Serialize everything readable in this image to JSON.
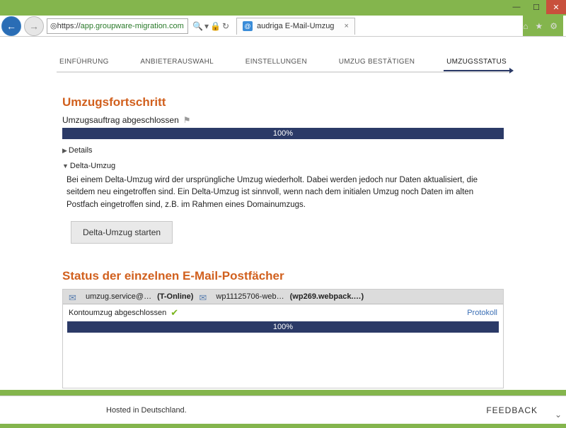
{
  "window": {
    "url_prefix": "https://",
    "url_host": "app.groupware-migration.com",
    "tab_title": "audriga E-Mail-Umzug"
  },
  "steps": {
    "s1": "EINFÜHRUNG",
    "s2": "ANBIETERAUSWAHL",
    "s3": "EINSTELLUNGEN",
    "s4": "UMZUG BESTÄTIGEN",
    "s5": "UMZUGSSTATUS"
  },
  "progress": {
    "heading": "Umzugsfortschritt",
    "status": "Umzugsauftrag abgeschlossen",
    "percent": "100%",
    "details_label": "Details",
    "delta_label": "Delta-Umzug",
    "delta_text": "Bei einem Delta-Umzug wird der ursprüngliche Umzug wiederholt. Dabei werden jedoch nur Daten aktualisiert, die seitdem neu eingetroffen sind. Ein Delta-Umzug ist sinnvoll, wenn nach dem initialen Umzug noch Daten im alten Postfach eingetroffen sind, z.B. im Rahmen eines Domainumzugs.",
    "delta_button": "Delta-Umzug starten"
  },
  "mailboxes": {
    "heading": "Status der einzelnen E-Mail-Postfächer",
    "from_addr": "umzug.service@…",
    "from_provider": "(T-Online)",
    "to_addr": "wp11125706-web…",
    "to_provider": "(wp269.webpack.…)",
    "row_status": "Kontoumzug abgeschlossen",
    "row_percent": "100%",
    "protokoll": "Protokoll"
  },
  "footer": {
    "hosted": "Hosted in Deutschland.",
    "feedback": "FEEDBACK"
  }
}
